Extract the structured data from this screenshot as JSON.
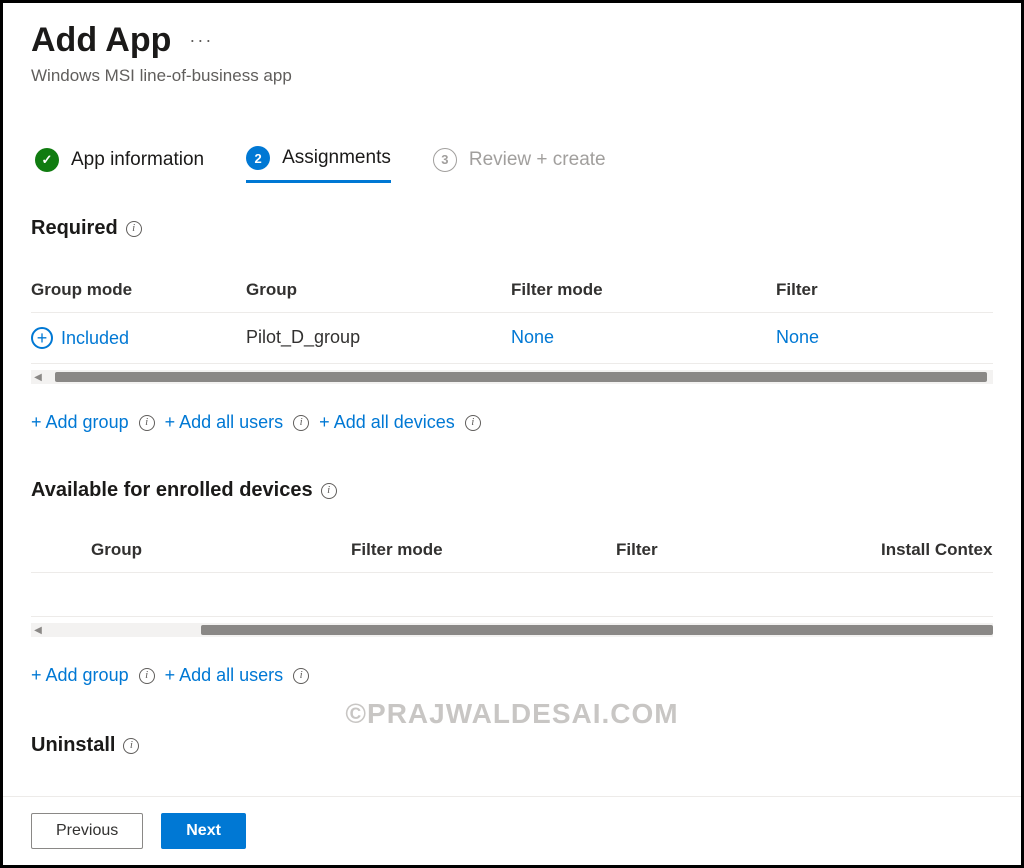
{
  "header": {
    "title": "Add App",
    "subtitle": "Windows MSI line-of-business app",
    "more_actions_glyph": "···"
  },
  "steps": {
    "s1": {
      "label": "App information",
      "badge": "✓"
    },
    "s2": {
      "label": "Assignments",
      "badge": "2"
    },
    "s3": {
      "label": "Review + create",
      "badge": "3"
    }
  },
  "sections": {
    "required": {
      "title": "Required",
      "columns": {
        "group_mode": "Group mode",
        "group": "Group",
        "filter_mode": "Filter mode",
        "filter": "Filter"
      },
      "rows": [
        {
          "mode_label": "Included",
          "group": "Pilot_D_group",
          "filter_mode": "None",
          "filter": "None"
        }
      ]
    },
    "available": {
      "title": "Available for enrolled devices",
      "columns": {
        "group": "Group",
        "filter_mode": "Filter mode",
        "filter": "Filter",
        "install_context": "Install Contex"
      }
    },
    "uninstall": {
      "title": "Uninstall"
    }
  },
  "links": {
    "add_group": "+ Add group",
    "add_all_users": "+ Add all users",
    "add_all_devices": "+ Add all devices"
  },
  "buttons": {
    "previous": "Previous",
    "next": "Next"
  },
  "watermark": "©PRAJWALDESAI.COM"
}
